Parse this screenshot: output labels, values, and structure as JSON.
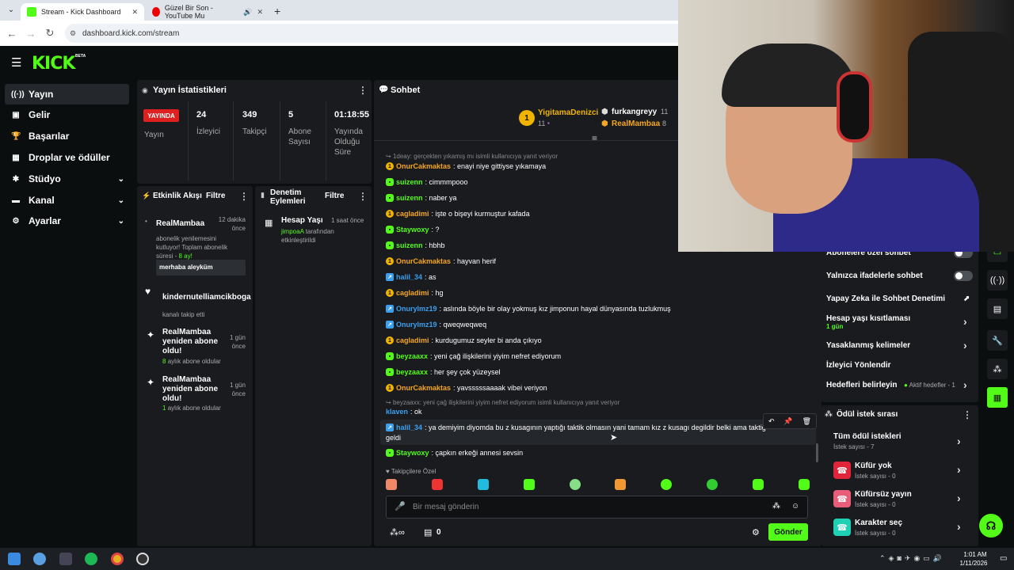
{
  "browser": {
    "tabs": [
      {
        "label": "Stream - Kick Dashboard"
      },
      {
        "label": "Güzel Bir Son - YouTube Mu"
      }
    ],
    "url": "dashboard.kick.com/stream"
  },
  "brand": {
    "logo": "KICK",
    "beta": "BETA",
    "accent": "#53fc18"
  },
  "sidebar": {
    "items": [
      {
        "label": "Yayın"
      },
      {
        "label": "Gelir"
      },
      {
        "label": "Başarılar"
      },
      {
        "label": "Droplar ve ödüller"
      },
      {
        "label": "Stüdyo"
      },
      {
        "label": "Kanal"
      },
      {
        "label": "Ayarlar"
      }
    ]
  },
  "stats": {
    "title": "Yayın İstatistikleri",
    "live_badge": "YAYINDA",
    "live_label": "Yayın",
    "viewers_value": "24",
    "viewers_label": "İzleyici",
    "followers_value": "349",
    "followers_label": "Takipçi",
    "subs_value": "5",
    "subs_label_1": "Abone",
    "subs_label_2": "Sayısı",
    "uptime_value": "01:18:55",
    "uptime_label_1": "Yayında",
    "uptime_label_2": "Olduğu",
    "uptime_label_3": "Süre"
  },
  "activity": {
    "title": "Etkinlik Akışı",
    "filter": "Filtre",
    "events": [
      {
        "user": "RealMambaa",
        "time_1": "12 dakika",
        "time_2": "önce",
        "desc_1": "abonelik yenilemesini",
        "desc_2": "kutluyor! Toplam abonelik",
        "desc_3": "süresi - ",
        "months": "8 ay!",
        "message": "merhaba aleyküm"
      },
      {
        "user": "kindernutelliamcikboga",
        "desc": "kanalı takip etti"
      },
      {
        "user_1": "RealMambaa",
        "user_2": "yeniden abone",
        "user_3": "oldu!",
        "time_1": "1 gün",
        "time_2": "önce",
        "count": "8",
        "desc": "aylık abone oldular"
      },
      {
        "user_1": "RealMambaa",
        "user_2": "yeniden abone",
        "user_3": "oldu!",
        "time_1": "1 gün",
        "time_2": "önce",
        "count": "1",
        "desc": "aylık abone oldular"
      }
    ]
  },
  "moderation": {
    "title_1": "Denetim",
    "title_2": "Eylemleri",
    "filter": "Filtre",
    "item_title": "Hesap Yaşı",
    "item_time": "1 saat önce",
    "item_user": "jimpoaA",
    "item_desc_1": " tarafından",
    "item_desc_2": "etkinleştirildi"
  },
  "chat": {
    "title": "Sohbet",
    "top_gifters": [
      {
        "rank": "1",
        "name": "YigitamaDenizci",
        "count": "11"
      },
      {
        "name": "furkangreyy",
        "count": "11"
      },
      {
        "name": "RealMambaa",
        "count": "8"
      }
    ],
    "reply_1": "1deay: gerçekten yıkamış mı isimli kullanıcıya yanıt veriyor",
    "messages": [
      {
        "user": "OnurCakmaktas",
        "text": ": enayi niye gittiyse yıkamaya",
        "color": "#f5a623"
      },
      {
        "user": "suizenn",
        "text": ": cimmmpooo",
        "color": "#53fc18"
      },
      {
        "user": "suizenn",
        "text": ": naber ya",
        "color": "#53fc18"
      },
      {
        "user": "cagladimi",
        "text": ": işte o bişeyi kurmuştur kafada",
        "color": "#f5a623"
      },
      {
        "user": "Staywoxy",
        "text": ": ?",
        "color": "#53fc18"
      },
      {
        "user": "suizenn",
        "text": ": hbhb",
        "color": "#53fc18"
      },
      {
        "user": "OnurCakmaktas",
        "text": ": hayvan herif",
        "color": "#f5a623"
      },
      {
        "user": "halil_34",
        "text": ": as",
        "color": "#3aa0f0"
      },
      {
        "user": "cagladimi",
        "text": ": hg",
        "color": "#f5a623"
      },
      {
        "user": "Onurylmz19",
        "text": ": aslında böyle bir olay yokmuş kız jimponun hayal dünyasında tuzlukmuş",
        "color": "#3aa0f0"
      },
      {
        "user": "Onurylmz19",
        "text": ": qweqweqweq",
        "color": "#3aa0f0"
      },
      {
        "user": "cagladimi",
        "text": ": kurdugumuz seyler bi anda çıkıyo",
        "color": "#f5a623"
      },
      {
        "user": "beyzaaxx",
        "text": ": yeni çağ ilişkilerini yiyim nefret ediyorum",
        "color": "#53fc18"
      },
      {
        "user": "beyzaaxx",
        "text": ": her şey çok yüzeysel",
        "color": "#53fc18"
      },
      {
        "user": "OnurCakmaktas",
        "text": ": yavsssssaaaak vibei veriyon",
        "color": "#f5a623"
      }
    ],
    "reply_2": "beyzaaxx: yeni çağ ilişkilerini yiyim nefret ediyorum isimli kullanıcıya yanıt veriyor",
    "klaven_user": "klaven",
    "klaven_text": ": ok",
    "long_user": "halil_34",
    "long_text_1": ": ya demiyim diyomda bu z kusagının yaptığı taktik olmasın yani tamam kız z kusagı degildir belki ama taktiğ",
    "long_text_2": "geldi",
    "last_user": "Staywoxy",
    "last_text": ": çapkın erkeği annesi sevsin",
    "emote_label": "Takipçilere Özel",
    "input_placeholder": "Bir mesaj gönderin",
    "points": "0",
    "send": "Gönder"
  },
  "chat_settings": {
    "row0": "Abonelere özel sohbet",
    "row1": "Yalnızca ifadelerle sohbet",
    "row2": "Yapay Zeka ile Sohbet Denetimi",
    "row3": "Hesap yaşı kısıtlaması",
    "row3_sub": "1 gün",
    "row4": "Yasaklanmış kelimeler",
    "row5": "İzleyici Yönlendir",
    "row6": "Hedefleri belirleyin",
    "row6_status": "Aktif hedefler - 1"
  },
  "rewards": {
    "title": "Ödül istek sırası",
    "all": "Tüm ödül istekleri",
    "all_sub": "İstek sayısı - 7",
    "items": [
      {
        "label": "Küfür yok",
        "sub": "İstek sayısı - 0"
      },
      {
        "label": "Küfürsüz yayın",
        "sub": "İstek sayısı - 0"
      },
      {
        "label": "Karakter seç",
        "sub": "İstek sayısı - 0"
      }
    ]
  },
  "taskbar": {
    "time": "1:01 AM",
    "date": "1/11/2026"
  }
}
